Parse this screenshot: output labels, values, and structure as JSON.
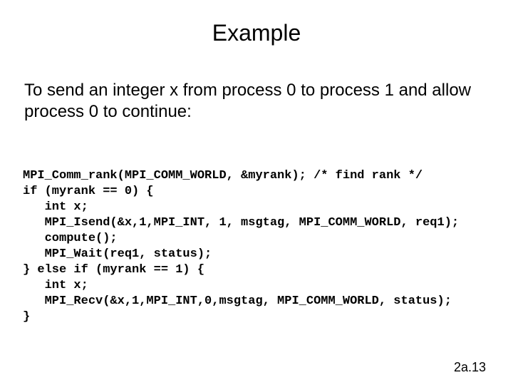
{
  "title": "Example",
  "description": "To send an integer x from process 0 to process 1\n  and allow process 0 to continue:",
  "code": "MPI_Comm_rank(MPI_COMM_WORLD, &myrank); /* find rank */\nif (myrank == 0) {\n   int x;\n   MPI_Isend(&x,1,MPI_INT, 1, msgtag, MPI_COMM_WORLD, req1);\n   compute();\n   MPI_Wait(req1, status);\n} else if (myrank == 1) {\n   int x;\n   MPI_Recv(&x,1,MPI_INT,0,msgtag, MPI_COMM_WORLD, status);\n}",
  "page_number": "2a.13"
}
